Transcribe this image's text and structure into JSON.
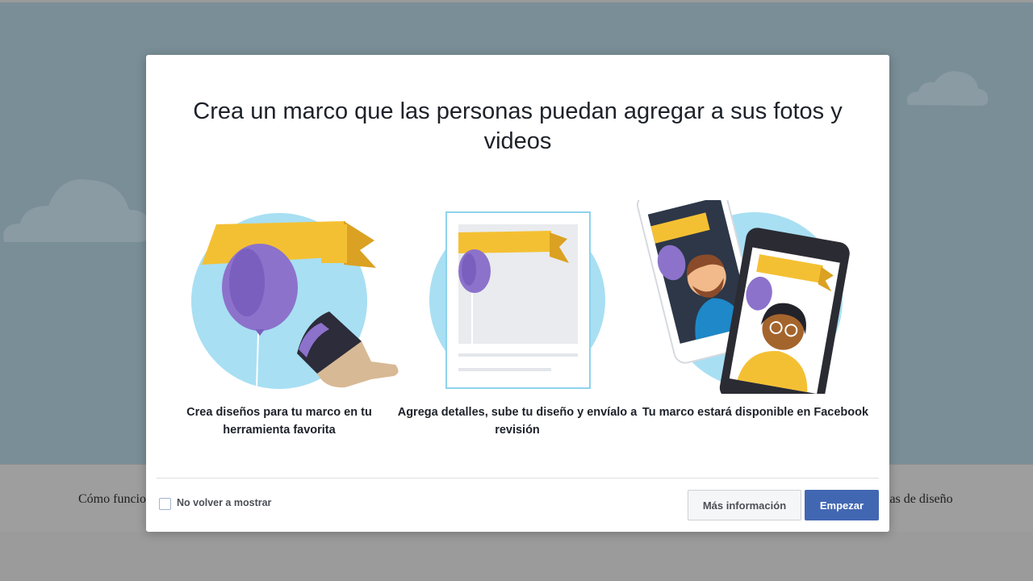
{
  "background": {
    "nav_left": "Cómo funcio",
    "nav_right": "tas de diseño"
  },
  "modal": {
    "title": "Crea un marco que las personas puedan agregar a sus fotos y videos",
    "steps": [
      {
        "text": "Crea diseños para tu marco en tu herramienta favorita",
        "icon": "balloon-brush-icon"
      },
      {
        "text": "Agrega detalles, sube tu diseño y envíalo a revisión",
        "icon": "frame-upload-icon"
      },
      {
        "text": "Tu marco estará disponible en Facebook",
        "icon": "phones-people-icon"
      }
    ],
    "dont_show_label": "No volver a mostrar",
    "more_info_label": "Más información",
    "start_label": "Empezar"
  },
  "colors": {
    "primary": "#4267b2",
    "circle": "#a8dff3",
    "ribbon": "#f4c033",
    "balloon": "#8c72cb"
  }
}
